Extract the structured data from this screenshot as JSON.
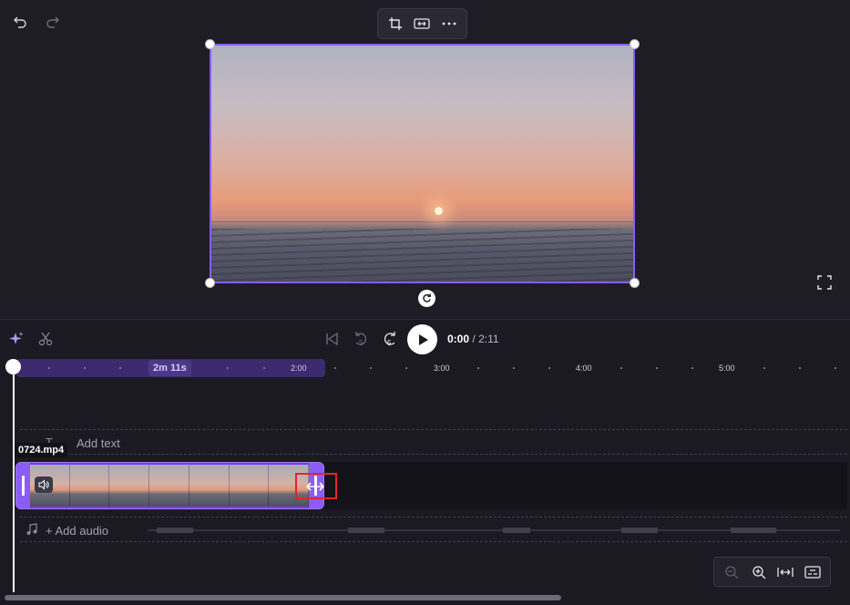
{
  "editor": {
    "undo_icon": "undo-icon",
    "redo_icon": "redo-icon",
    "context_toolbar": [
      "crop-icon",
      "fit-icon",
      "more-icon"
    ],
    "fullscreen_icon": "fullscreen-icon"
  },
  "playback": {
    "current_time": "0:00",
    "separator": "/",
    "total_time": "2:11",
    "rewind_label": "5",
    "forward_label": "5"
  },
  "ruler": {
    "duration_tag": "2m 11s",
    "ticks": [
      "2:00",
      "3:00",
      "4:00",
      "5:00"
    ]
  },
  "tracks": {
    "text_placeholder": "Add text",
    "text_icon": "T",
    "clip_name": "0724.mp4",
    "audio_placeholder": "+ Add audio"
  },
  "colors": {
    "accent": "#8b5cf6",
    "trim_highlight": "#e0272b"
  }
}
